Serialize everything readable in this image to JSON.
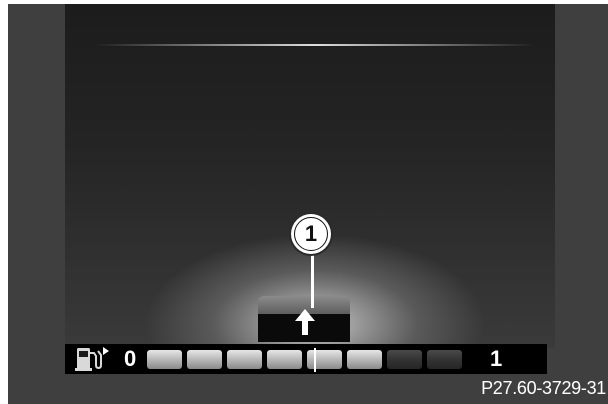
{
  "display": {
    "scale_min": "0",
    "scale_max": "1",
    "segments": [
      {
        "state": "on"
      },
      {
        "state": "on"
      },
      {
        "state": "on"
      },
      {
        "state": "on"
      },
      {
        "state": "on"
      },
      {
        "state": "on"
      },
      {
        "state": "off"
      },
      {
        "state": "off"
      }
    ],
    "level_fraction": 0.75,
    "callout_number": "1",
    "icons": {
      "fuel": "fuel-pump-icon",
      "pointer": "triangle-right-icon",
      "shift": "up-arrow-icon"
    }
  },
  "caption": "P27.60-3729-31",
  "colors": {
    "bar_background": "#000000",
    "segment_on": "#bdbdbd",
    "segment_off": "#333333",
    "frame": "#3f3f3f"
  }
}
